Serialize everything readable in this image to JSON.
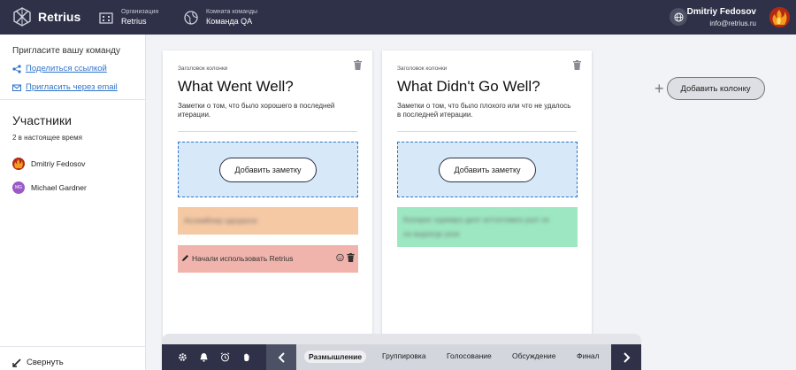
{
  "header": {
    "app_name": "Retrius",
    "org_label": "Организация",
    "org_value": "Retrius",
    "team_label": "Комната команды",
    "team_value": "Команда QA",
    "user_name": "Dmitriy Fedosov",
    "user_email": "info@retrius.ru"
  },
  "sidebar": {
    "invite_title": "Пригласите вашу команду",
    "share_link": "Поделиться ссылкой",
    "invite_email": "Пригласить через email",
    "members_title": "Участники",
    "members_count": "2 в настоящее время",
    "members": [
      {
        "name": "Dmitriy Fedosov",
        "initials": ""
      },
      {
        "name": "Michael Gardner",
        "initials": "MG"
      }
    ],
    "collapse_label": "Свернуть"
  },
  "columns": [
    {
      "caption": "Заголовок колонки",
      "title": "What Went Well?",
      "description": "Заметки о том, что было хорошего в последней итерации.",
      "add_note": "Добавить заметку",
      "notes": [
        {
          "text": "Ассемблер одоуроси",
          "blurred": true,
          "color": "#f5c9a4"
        },
        {
          "text": "Начали использовать Retrius",
          "blurred": false,
          "color": "#f0b4ac"
        }
      ]
    },
    {
      "caption": "Заголовок колонки",
      "title": "What Didn't Go Well?",
      "description": "Заметки о том, что было плохого или что не удалось в последней итерации.",
      "add_note": "Добавить заметку",
      "notes": [
        {
          "text": "Колорат хуремрэ дилг алтэлтимга ушгг кэ",
          "text2": "оэ ашрэгур уоэх",
          "blurred": true,
          "color": "#9de8c3"
        }
      ]
    }
  ],
  "add_column_label": "Добавить колонку",
  "stages": [
    "Размышление",
    "Группировка",
    "Голосование",
    "Обсуждение",
    "Финал"
  ],
  "active_stage": "Размышление",
  "colors": {
    "header_bg": "#2e3147",
    "accent": "#2f73c9",
    "note_orange": "#f5c9a4",
    "note_red": "#f0b4ac",
    "note_green": "#9de8c3"
  },
  "icons": [
    "logo-icon",
    "building-icon",
    "globe-icon",
    "share-icon",
    "mail-icon",
    "trash-icon",
    "pencil-icon",
    "smile-icon",
    "settings-icon",
    "bell-icon",
    "alarm-icon",
    "hand-icon",
    "chevron-left-icon",
    "chevron-right-icon",
    "collapse-icon"
  ]
}
